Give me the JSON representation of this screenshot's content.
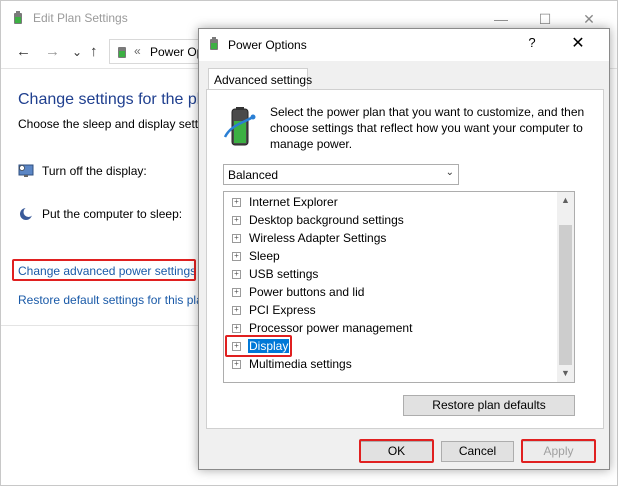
{
  "background_window": {
    "title": "Edit Plan Settings",
    "window_controls": {
      "minimize": "—",
      "maximize": "☐",
      "close": "✕"
    },
    "nav": {
      "back": "←",
      "forward": "→",
      "dropdown": "⌄",
      "up": "↑",
      "crumb_sep": "«",
      "breadcrumb": "Power Op"
    },
    "heading": "Change settings for the pla",
    "subheading": "Choose the sleep and display setti",
    "rows": [
      {
        "label": "Turn off the display:",
        "icon": "monitor-icon"
      },
      {
        "label": "Put the computer to sleep:",
        "icon": "moon-icon"
      }
    ],
    "links": {
      "advanced": "Change advanced power settings",
      "restore": "Restore default settings for this pla"
    }
  },
  "dialog": {
    "title": "Power Options",
    "help": "?",
    "close": "✕",
    "tab": "Advanced settings",
    "intro": "Select the power plan that you want to customize, and then choose settings that reflect how you want your computer to manage power.",
    "plan_select": {
      "value": "Balanced",
      "chevron": "⌄"
    },
    "tree_items": [
      {
        "label": "Internet Explorer"
      },
      {
        "label": "Desktop background settings"
      },
      {
        "label": "Wireless Adapter Settings"
      },
      {
        "label": "Sleep"
      },
      {
        "label": "USB settings"
      },
      {
        "label": "Power buttons and lid"
      },
      {
        "label": "PCI Express"
      },
      {
        "label": "Processor power management"
      },
      {
        "label": "Display",
        "selected": true
      },
      {
        "label": "Multimedia settings"
      }
    ],
    "expand_glyph": "+",
    "scroll": {
      "up": "▲",
      "down": "▼"
    },
    "buttons": {
      "restore_defaults": "Restore plan defaults",
      "ok": "OK",
      "cancel": "Cancel",
      "apply": "Apply"
    }
  },
  "colors": {
    "highlight": "#e02020",
    "selection": "#0078d7",
    "link": "#1a5aa8"
  }
}
